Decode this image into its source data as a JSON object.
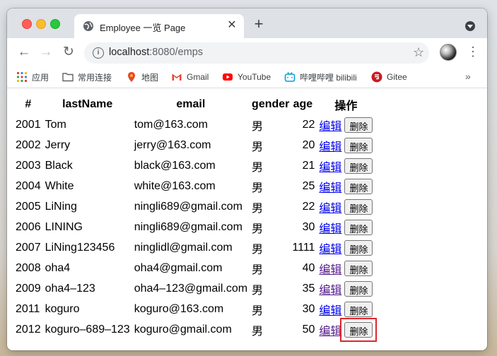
{
  "browser": {
    "tab_title": "Employee 一览 Page",
    "url_host": "localhost",
    "url_rest": ":8080/emps",
    "bookmarks": [
      "应用",
      "常用连接",
      "地图",
      "Gmail",
      "YouTube",
      "哔哩哔哩 bilibili",
      "Gitee"
    ]
  },
  "table": {
    "headers": [
      "#",
      "lastName",
      "email",
      "gender",
      "age",
      "操作"
    ],
    "edit_label": "编辑",
    "delete_label": "删除",
    "rows": [
      {
        "id": "2001",
        "lastName": "Tom",
        "email": "tom@163.com",
        "gender": "男",
        "age": "22",
        "edit_visited": false
      },
      {
        "id": "2002",
        "lastName": "Jerry",
        "email": "jerry@163.com",
        "gender": "男",
        "age": "20",
        "edit_visited": false
      },
      {
        "id": "2003",
        "lastName": "Black",
        "email": "black@163.com",
        "gender": "男",
        "age": "21",
        "edit_visited": false
      },
      {
        "id": "2004",
        "lastName": "White",
        "email": "white@163.com",
        "gender": "男",
        "age": "25",
        "edit_visited": false
      },
      {
        "id": "2005",
        "lastName": "LiNing",
        "email": "ningli689@gmail.com",
        "gender": "男",
        "age": "22",
        "edit_visited": false
      },
      {
        "id": "2006",
        "lastName": "LINING",
        "email": "ningli689@gmail.com",
        "gender": "男",
        "age": "30",
        "edit_visited": false
      },
      {
        "id": "2007",
        "lastName": "LiNing123456",
        "email": "ninglidl@gmail.com",
        "gender": "男",
        "age": "1111",
        "edit_visited": false
      },
      {
        "id": "2008",
        "lastName": "oha4",
        "email": "oha4@gmail.com",
        "gender": "男",
        "age": "40",
        "edit_visited": true
      },
      {
        "id": "2009",
        "lastName": "oha4–123",
        "email": "oha4–123@gmail.com",
        "gender": "男",
        "age": "35",
        "edit_visited": true
      },
      {
        "id": "2011",
        "lastName": "koguro",
        "email": "koguro@163.com",
        "gender": "男",
        "age": "30",
        "edit_visited": false
      },
      {
        "id": "2012",
        "lastName": "koguro–689–123",
        "email": "koguro@gmail.com",
        "gender": "男",
        "age": "50",
        "edit_visited": true
      }
    ]
  },
  "colors": {
    "link": "#0000ee",
    "link_visited": "#551a8b",
    "highlight": "#e0252b"
  }
}
